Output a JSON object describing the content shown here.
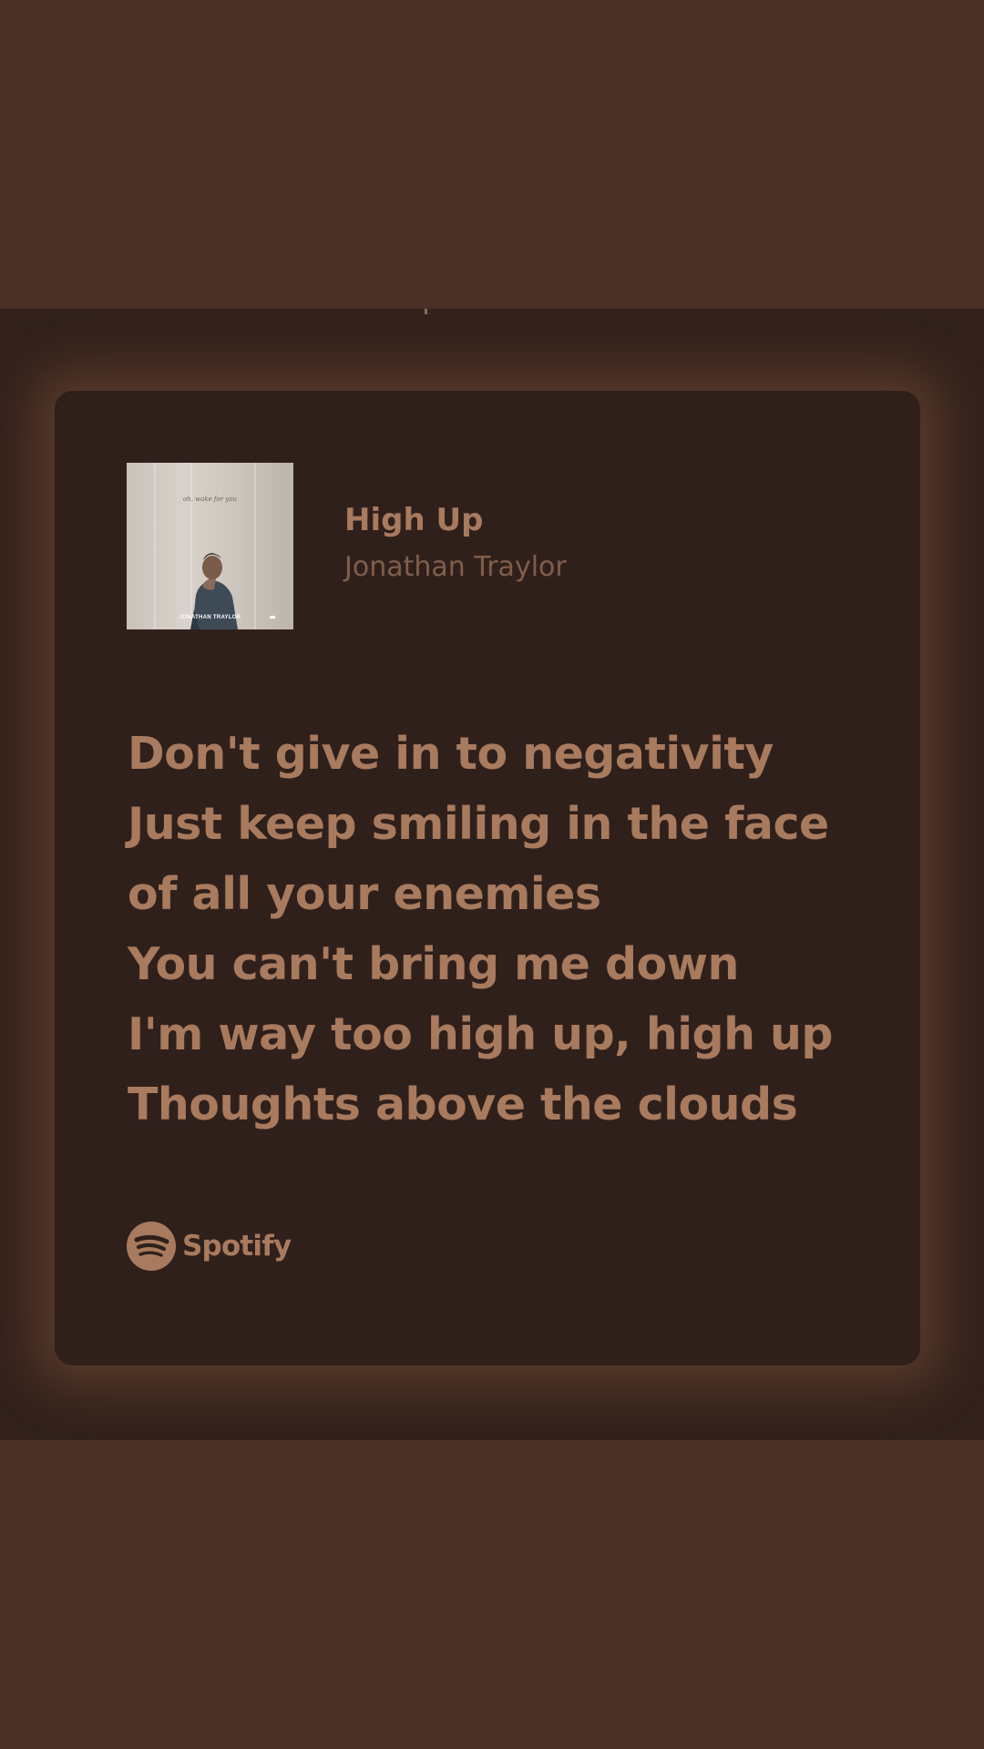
{
  "colors": {
    "outer_background": "#4a3026",
    "stage_background": "#33221c",
    "card_background": "#30201b",
    "accent_text": "#a87a5e",
    "secondary_text": "#7f5e4b"
  },
  "album_art": {
    "cover_title": "oh, wake for you",
    "cover_artist": "JONATHAN TRAYLOR"
  },
  "track": {
    "title": "High Up",
    "artist": "Jonathan Traylor"
  },
  "lyrics": [
    "Don't give in to negativity",
    "Just keep smiling in the face",
    "of all your enemies",
    "You can't bring me down",
    "I'm way too high up, high up",
    "Thoughts above the clouds"
  ],
  "brand": {
    "name": "Spotify",
    "logo_icon": "spotify-logo-icon"
  }
}
